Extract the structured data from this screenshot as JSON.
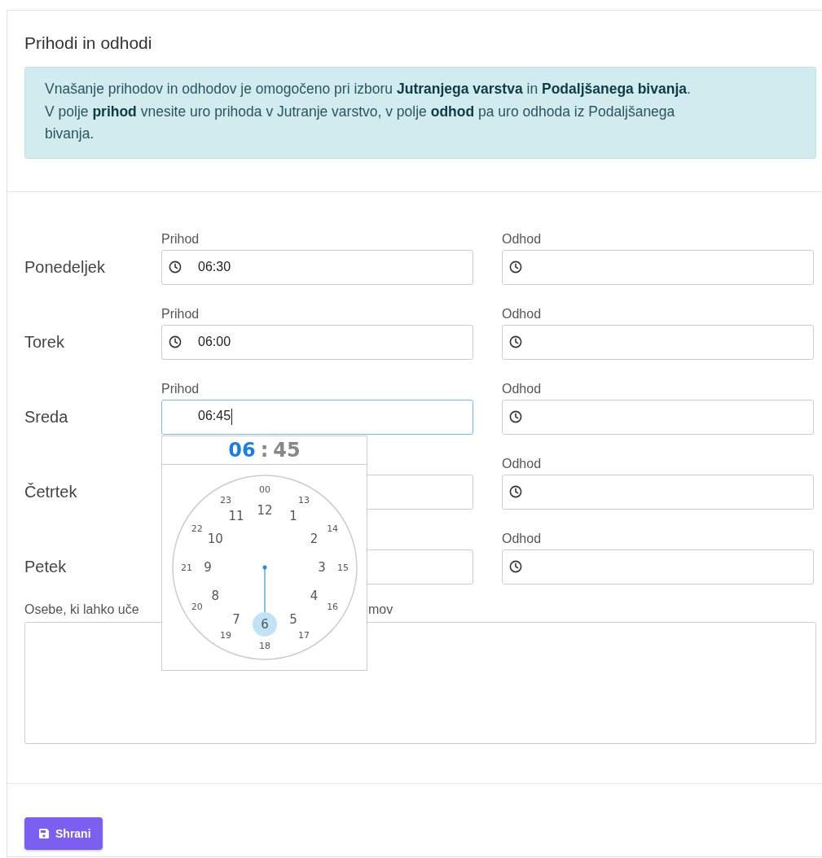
{
  "title": "Prihodi in odhodi",
  "notice_lines": [
    "Vnašanje prihodov in odhodov je omogočeno pri izboru **Jutranjega varstva** in **Podaljšanega bivanja**.",
    "V polje **prihod** vnesite uro prihoda v Jutranje varstvo, v polje **odhod** pa uro odhoda iz Podaljšanega bivanja."
  ],
  "days": [
    {
      "name": "Ponedeljek",
      "arrival": {
        "label": "Prihod",
        "value": "06:30",
        "focused": false,
        "clock_icon": true
      },
      "departure": {
        "label": "Odhod",
        "focused": false,
        "clock_icon": true
      }
    },
    {
      "name": "Torek",
      "arrival": {
        "label": "Prihod",
        "value": "06:00",
        "focused": false,
        "clock_icon": true
      },
      "departure": {
        "label": "Odhod",
        "focused": false,
        "clock_icon": true
      }
    },
    {
      "name": "Sreda",
      "arrival": {
        "label": "Prihod",
        "value": "06:45",
        "focused": true,
        "clock_icon": false
      },
      "departure": {
        "label": "Odhod",
        "focused": false,
        "clock_icon": true
      }
    },
    {
      "name": "Četrtek",
      "arrival": {
        "focused": false,
        "clock_icon": false
      },
      "departure": {
        "label": "Odhod",
        "focused": false,
        "clock_icon": true
      }
    },
    {
      "name": "Petek",
      "arrival": {
        "focused": false,
        "clock_icon": false
      },
      "departure": {
        "label": "Odhod",
        "focused": false,
        "clock_icon": true
      }
    }
  ],
  "picker": {
    "hour": "06",
    "separator": ":",
    "minute": "45",
    "inner": [
      {
        "label": "12",
        "selected": false
      },
      {
        "label": "1",
        "selected": false
      },
      {
        "label": "2",
        "selected": false
      },
      {
        "label": "3",
        "selected": false
      },
      {
        "label": "4",
        "selected": false
      },
      {
        "label": "5",
        "selected": false
      },
      {
        "label": "6",
        "selected": true
      },
      {
        "label": "7",
        "selected": false
      },
      {
        "label": "8",
        "selected": false
      },
      {
        "label": "9",
        "selected": false
      },
      {
        "label": "10",
        "selected": false
      },
      {
        "label": "11",
        "selected": false
      }
    ],
    "outer": [
      {
        "label": "00",
        "selected": false
      },
      {
        "label": "13",
        "selected": false
      },
      {
        "label": "14",
        "selected": false
      },
      {
        "label": "15",
        "selected": false
      },
      {
        "label": "16",
        "selected": false
      },
      {
        "label": "17",
        "selected": false
      },
      {
        "label": "18",
        "selected": false
      },
      {
        "label": "19",
        "selected": false
      },
      {
        "label": "20",
        "selected": false
      },
      {
        "label": "21",
        "selected": false
      },
      {
        "label": "22",
        "selected": false
      },
      {
        "label": "23",
        "selected": false
      }
    ]
  },
  "persons": {
    "label_visible_parts": [
      "Osebe, ki lahko uče",
      "mov"
    ]
  },
  "save_button": {
    "label": "Shrani"
  }
}
